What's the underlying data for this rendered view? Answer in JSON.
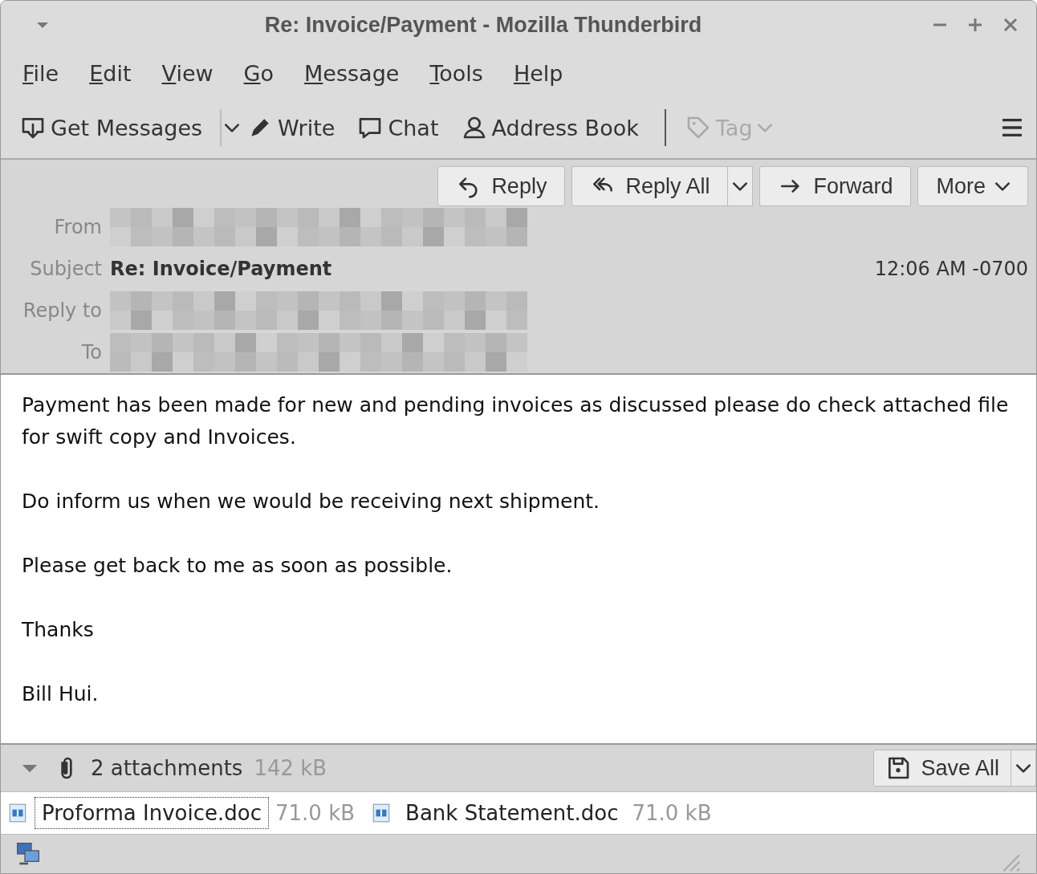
{
  "window": {
    "title": "Re: Invoice/Payment - Mozilla Thunderbird"
  },
  "menu": [
    "File",
    "Edit",
    "View",
    "Go",
    "Message",
    "Tools",
    "Help"
  ],
  "toolbar": [
    {
      "kind": "get",
      "label": "Get Messages",
      "disabled": false
    },
    {
      "kind": "write",
      "label": "Write",
      "disabled": false
    },
    {
      "kind": "chat",
      "label": "Chat",
      "disabled": false
    },
    {
      "kind": "addressbook",
      "label": "Address Book",
      "disabled": false
    },
    {
      "kind": "tag",
      "label": "Tag",
      "disabled": true
    }
  ],
  "header_buttons": [
    {
      "kind": "reply",
      "label": "Reply"
    },
    {
      "kind": "replyall",
      "label": "Reply All"
    },
    {
      "kind": "forward",
      "label": "Forward"
    },
    {
      "kind": "more",
      "label": "More"
    }
  ],
  "header_fields": [
    {
      "label": "From",
      "redacted": true
    },
    {
      "label": "Subject",
      "value": "Re: Invoice/Payment",
      "date": "12:06 AM -0700"
    },
    {
      "label": "Reply to",
      "redacted": true
    },
    {
      "label": "To",
      "redacted": true
    }
  ],
  "body": [
    "Payment has been made for new and pending invoices as discussed please do check attached file for swift copy and Invoices.",
    "Do inform us when we would be receiving next shipment.",
    "Please get back to me as soon as possible.",
    "Thanks",
    "Bill Hui."
  ],
  "attachments_bar": {
    "count": "2 attachments",
    "size": "142 kB",
    "save_all": "Save All"
  },
  "attachments": [
    {
      "name": "Proforma Invoice.doc",
      "size": "71.0 kB",
      "focused": true
    },
    {
      "name": "Bank Statement.doc",
      "size": "71.0 kB",
      "focused": false
    }
  ]
}
